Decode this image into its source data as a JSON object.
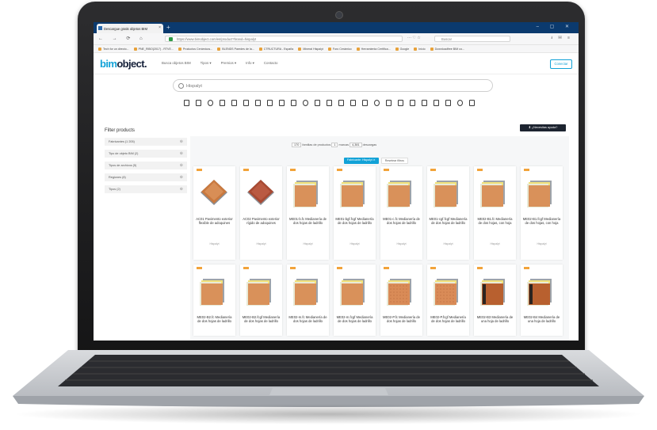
{
  "browser": {
    "tab_title": "Descargue gratis objetos BIM",
    "new_tab": "+",
    "window_controls": "– ▢ ✕",
    "nav_buttons": "← → ⟳ ⌂",
    "url": "https://www.bimobject.com/es/product?brand=hispalyt",
    "search_placeholder": "Buscar",
    "menu_icons": "⭳ ▤ ≡",
    "bookmarks": [
      "Tech for un directo...",
      "PNE_RIBO(2017) - RTVE...",
      "Productos Cerámicos...",
      "BLENDS Paredes de la...",
      "CTRUCTURA - España",
      "Mineral Hispalyt",
      "Foro Cerámico",
      "Herramienta Certifica...",
      "Google",
      "Inicio",
      "Downloadfree BIM co..."
    ]
  },
  "site": {
    "logo_part1": "bim",
    "logo_part2": "object.",
    "nav": [
      "Busca objetos BIM",
      "Tipos ▾",
      "Premios ▾",
      "Info ▾",
      "Contacto"
    ],
    "connect_label": "Conectar",
    "search_value": "Hispalyt",
    "download_button": "⬇ ¿Necesitas ayuda?",
    "filter_title": "Filter products",
    "filters": [
      "Fabricantes (1 205)",
      "Tipo de objeto BIM (2)",
      "Tipos de archivos (5)",
      "Regiones (8)",
      "Tipos (2)"
    ],
    "summary": {
      "products_count": "170",
      "products_label": "familias de productos",
      "brands_count": "1",
      "brands_label": "marcas",
      "downloads_count": "4,381",
      "downloads_label": "descargas"
    },
    "active_filter": "Fabricante: Hispalyt ✕",
    "reset_filter": "Resetear filtros"
  },
  "products": [
    {
      "title": "AC01 Pavimento exterior flexible de adoquines",
      "brand": "Hispalyt",
      "style": "paver1"
    },
    {
      "title": "AC02 Pavimento exterior rígido de adoquines",
      "brand": "Hispalyt",
      "style": "paver2"
    },
    {
      "title": "ME01-b.fc Medianería de dos hojas de ladrillo",
      "brand": "Hispalyt",
      "style": "wall"
    },
    {
      "title": "ME01-bgf.fcgf Medianería de dos hojas de ladrillo",
      "brand": "Hispalyt",
      "style": "wall"
    },
    {
      "title": "ME01-c.fc Medianería de dos hojas de ladrillo",
      "brand": "Hispalyt",
      "style": "wall"
    },
    {
      "title": "ME01-cgf.fcgf Medianería de dos hojas de ladrillo",
      "brand": "Hispalyt",
      "style": "wall"
    },
    {
      "title": "ME02-B1.fc Medianería de dos hojas, con hoja",
      "brand": "Hispalyt",
      "style": "wall"
    },
    {
      "title": "ME02-B1.fcgf Medianería de dos hojas, con hoja",
      "brand": "Hispalyt",
      "style": "wall"
    },
    {
      "title": "ME02-B2.fc Medianería de dos hojas de ladrillo",
      "brand": "Hispalyt",
      "style": "wall"
    },
    {
      "title": "ME02-B2.fcgf Medianería de dos hojas de ladrillo",
      "brand": "Hispalyt",
      "style": "wall"
    },
    {
      "title": "ME02-m.fc Medianería de dos hojas de ladrillo",
      "brand": "Hispalyt",
      "style": "wall"
    },
    {
      "title": "ME02-m.fcgf Medianería de dos hojas de ladrillo",
      "brand": "Hispalyt",
      "style": "wall"
    },
    {
      "title": "ME02-P.fc Medianería de dos hojas de ladrillo",
      "brand": "Hispalyt",
      "style": "dotted"
    },
    {
      "title": "ME02-P.fcgf Medianería de dos hojas de ladrillo",
      "brand": "Hispalyt",
      "style": "dotted"
    },
    {
      "title": "ME02-B3 Medianería de una hoja de ladrillo",
      "brand": "Hispalyt",
      "style": "dark"
    },
    {
      "title": "ME02-B4 Medianería de una hoja de ladrillo",
      "brand": "Hispalyt",
      "style": "dark"
    }
  ],
  "colors": {
    "accent": "#12a2d7",
    "brand_navy": "#16213a",
    "brick": "#c9793f",
    "tag": "#f2a33a"
  }
}
